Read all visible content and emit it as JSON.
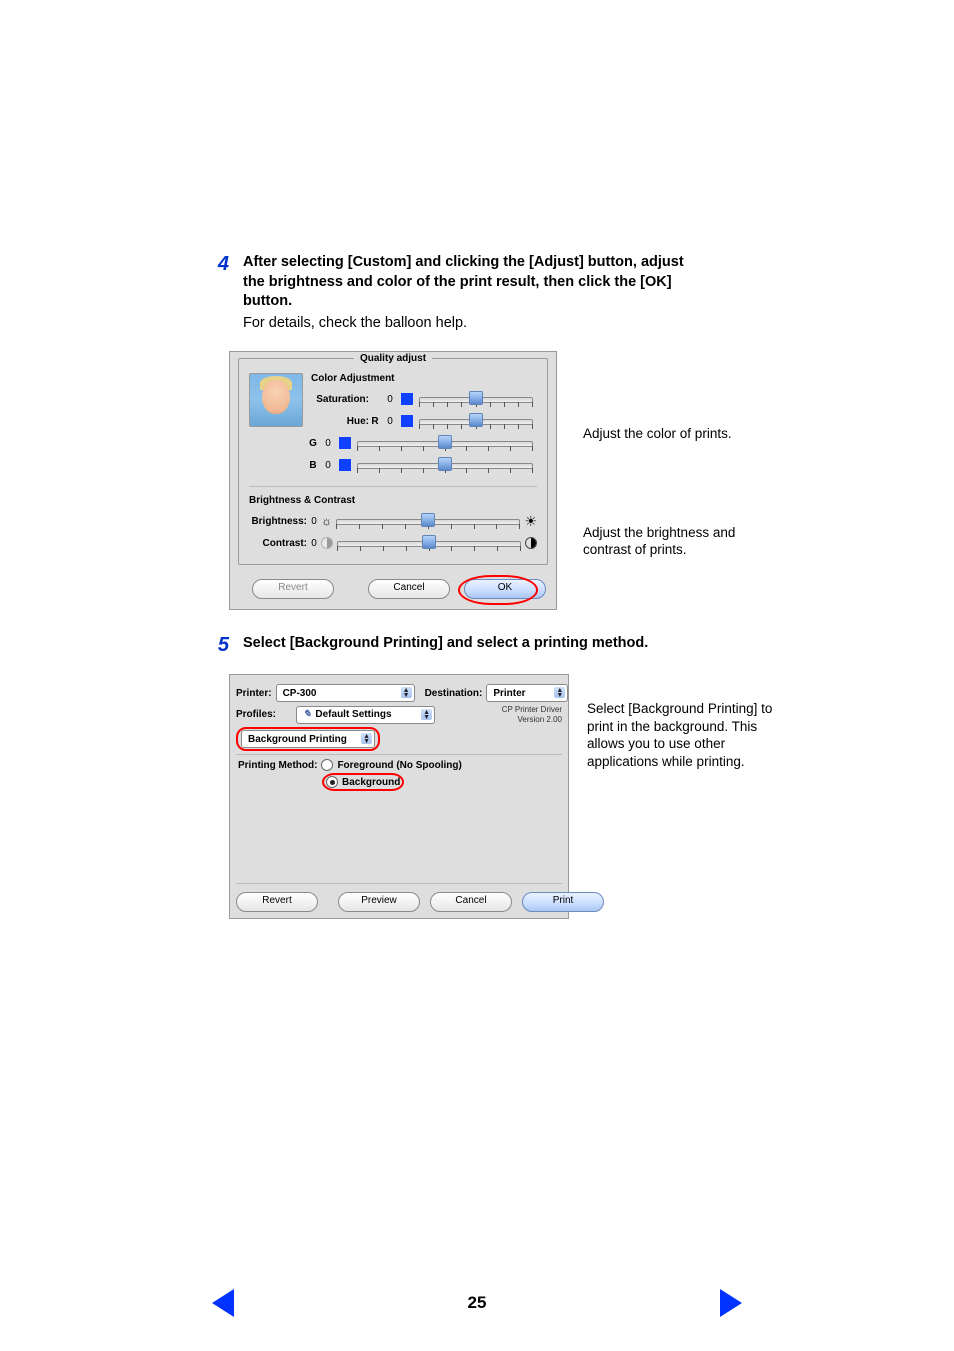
{
  "steps": {
    "s4": {
      "num": "4",
      "title_line1": "After selecting [Custom] and clicking the [Adjust] button, adjust",
      "title_line2": "the brightness and color of the print result, then click the [OK]",
      "title_line3": "button.",
      "sub": "For details, check the balloon help."
    },
    "s5": {
      "num": "5",
      "title": "Select [Background Printing] and select a printing method."
    }
  },
  "quality_adjust": {
    "groupbox_title": "Quality adjust",
    "section_color": "Color Adjustment",
    "saturation_label": "Saturation:",
    "saturation_value": "0",
    "hue_label": "Hue:",
    "hue_r": "R",
    "hue_r_value": "0",
    "hue_g": "G",
    "hue_g_value": "0",
    "hue_b": "B",
    "hue_b_value": "0",
    "section_bc": "Brightness & Contrast",
    "brightness_label": "Brightness:",
    "brightness_value": "0",
    "contrast_label": "Contrast:",
    "contrast_value": "0",
    "btn_revert": "Revert",
    "btn_cancel": "Cancel",
    "btn_ok": "OK"
  },
  "quality_callouts": {
    "color": "Adjust the color of prints.",
    "bc": "Adjust the brightness and contrast of prints."
  },
  "print_dialog": {
    "printer_label": "Printer:",
    "printer_value": "CP-300",
    "destination_label": "Destination:",
    "destination_value": "Printer",
    "profiles_label": "Profiles:",
    "profiles_value": "Default Settings",
    "tab_value": "Background Printing",
    "driver_name": "CP Printer Driver",
    "driver_version": "Version 2.00",
    "method_label": "Printing Method:",
    "method_foreground": "Foreground (No Spooling)",
    "method_background": "Background",
    "btn_revert": "Revert",
    "btn_preview": "Preview",
    "btn_cancel": "Cancel",
    "btn_print": "Print"
  },
  "print_callout": "Select [Background Printing] to print in the background. This allows you to use other applications while printing.",
  "page_number": "25"
}
